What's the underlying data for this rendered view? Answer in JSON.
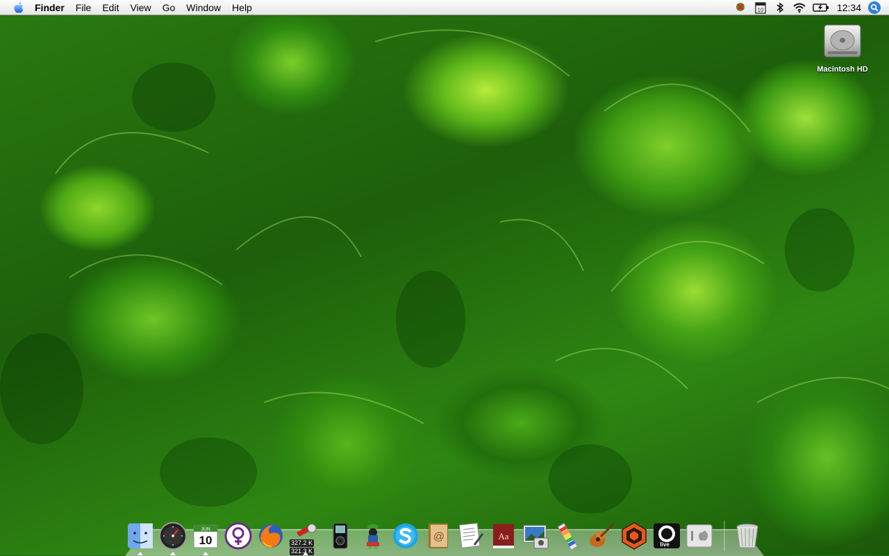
{
  "menubar": {
    "apple_icon": "apple-icon",
    "app_name": "Finder",
    "menus": [
      "File",
      "Edit",
      "View",
      "Go",
      "Window",
      "Help"
    ],
    "status_icons": [
      "growl-status-icon",
      "ical-status-icon",
      "bluetooth-icon",
      "wifi-icon",
      "battery-icon"
    ],
    "ical_day": "10",
    "clock": "12:34",
    "spotlight_icon": "spotlight-icon"
  },
  "desktop": {
    "hd_label": "Macintosh HD"
  },
  "dock": {
    "apps": [
      {
        "name": "Finder",
        "icon": "finder-icon",
        "running": true
      },
      {
        "name": "Dashboard",
        "icon": "dashboard-icon",
        "running": true
      },
      {
        "name": "iCal",
        "icon": "ical-icon",
        "running": true,
        "month": "JUN",
        "day": "10"
      },
      {
        "name": "Adium",
        "icon": "adium-icon",
        "running": false
      },
      {
        "name": "Firefox",
        "icon": "firefox-icon",
        "running": false
      },
      {
        "name": "Network Monitor",
        "icon": "network-monitor-icon",
        "running": true,
        "upload": "327.2 K",
        "download": "321.3 K"
      },
      {
        "name": "iPod",
        "icon": "ipod-icon",
        "running": false
      },
      {
        "name": "Marvin",
        "icon": "marvin-icon",
        "running": false
      },
      {
        "name": "Skype",
        "icon": "skype-icon",
        "running": false
      },
      {
        "name": "Address Book",
        "icon": "address-book-icon",
        "running": false
      },
      {
        "name": "Preview",
        "icon": "preview-icon",
        "running": false
      },
      {
        "name": "Dictionary",
        "icon": "dictionary-icon",
        "running": false,
        "glyph": "Aa"
      },
      {
        "name": "iPhoto",
        "icon": "iphoto-icon",
        "running": false
      },
      {
        "name": "Color Picker",
        "icon": "color-picker-icon",
        "running": false
      },
      {
        "name": "GarageBand",
        "icon": "garageband-icon",
        "running": false
      },
      {
        "name": "Reason",
        "icon": "reason-icon",
        "running": false
      },
      {
        "name": "Live",
        "icon": "live-icon",
        "running": false,
        "glyph": "live"
      },
      {
        "name": "Boot Camp",
        "icon": "bootcamp-icon",
        "running": false
      }
    ],
    "trash_icon": "trash-icon"
  }
}
